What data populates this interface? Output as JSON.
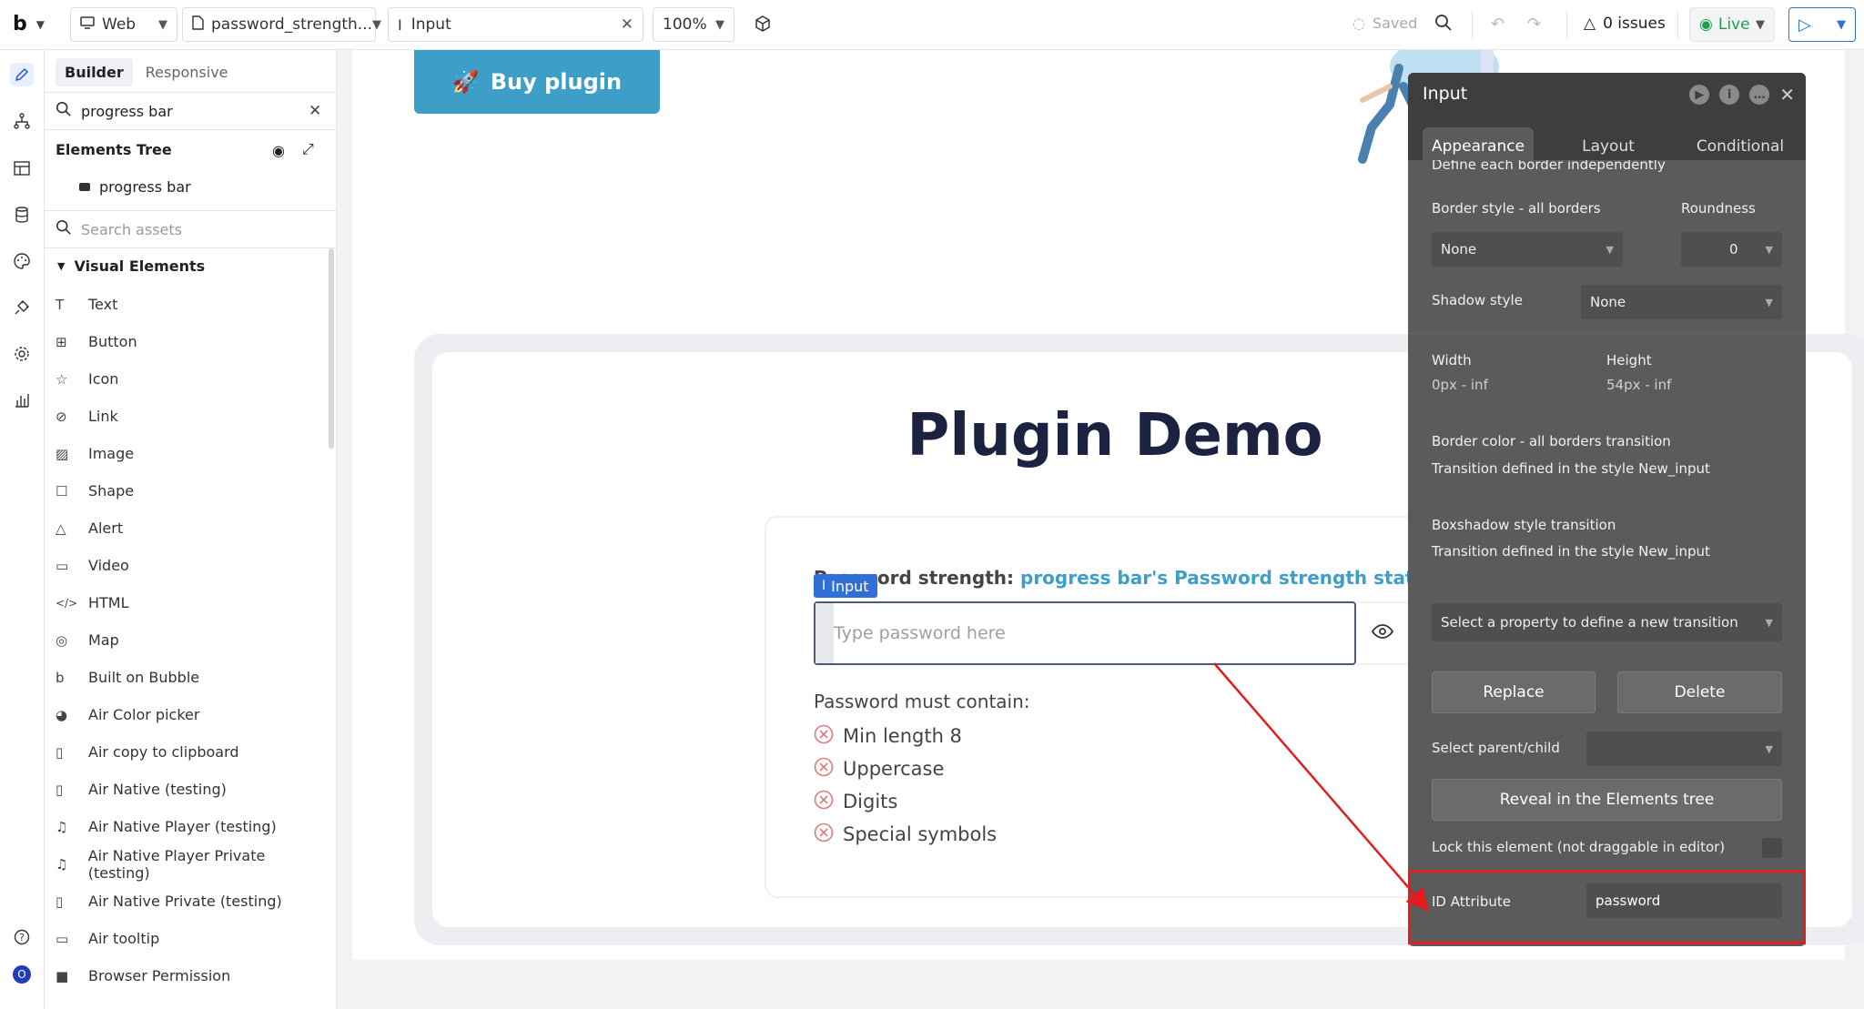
{
  "topbar": {
    "platform": "Web",
    "page": "password_strength...",
    "element": "Input",
    "zoom": "100%",
    "saved": "Saved",
    "issues": "0 issues",
    "live": "Live"
  },
  "sidebar": {
    "tabs": [
      "Builder",
      "Responsive"
    ],
    "search_value": "progress bar",
    "tree_title": "Elements Tree",
    "tree_item": "progress bar",
    "assets_placeholder": "Search assets",
    "category": "Visual Elements",
    "elements": [
      {
        "label": "Text",
        "icon": "text-icon"
      },
      {
        "label": "Button",
        "icon": "button-icon"
      },
      {
        "label": "Icon",
        "icon": "star-icon"
      },
      {
        "label": "Link",
        "icon": "link-icon"
      },
      {
        "label": "Image",
        "icon": "image-icon"
      },
      {
        "label": "Shape",
        "icon": "square-icon"
      },
      {
        "label": "Alert",
        "icon": "warning-icon"
      },
      {
        "label": "Video",
        "icon": "video-icon"
      },
      {
        "label": "HTML",
        "icon": "code-icon"
      },
      {
        "label": "Map",
        "icon": "map-pin-icon"
      },
      {
        "label": "Built on Bubble",
        "icon": "bubble-logo-icon"
      },
      {
        "label": "Air Color picker",
        "icon": "palette-icon"
      },
      {
        "label": "Air copy to clipboard",
        "icon": "clipboard-icon"
      },
      {
        "label": "Air Native (testing)",
        "icon": "phone-icon"
      },
      {
        "label": "Air Native Player (testing)",
        "icon": "music-icon"
      },
      {
        "label": "Air Native Player Private (testing)",
        "icon": "music-icon"
      },
      {
        "label": "Air Native Private (testing)",
        "icon": "phone-icon"
      },
      {
        "label": "Air tooltip",
        "icon": "tooltip-icon"
      },
      {
        "label": "Browser Permission",
        "icon": "square-filled-icon"
      }
    ]
  },
  "canvas": {
    "buy_button": "Buy plugin",
    "demo_title": "Plugin Demo",
    "strength_label": "Password strength:",
    "strength_dynamic": "progress bar's Password strength status",
    "input_badge": "Input",
    "password_placeholder": "Type password here",
    "must_contain": "Password must contain:",
    "rules": [
      "Min length 8",
      "Uppercase",
      "Digits",
      "Special symbols"
    ]
  },
  "property_editor": {
    "title": "Input",
    "tabs": [
      "Appearance",
      "Layout",
      "Conditional"
    ],
    "border_independent": "Define each border independently",
    "border_style_label": "Border style - all borders",
    "roundness_label": "Roundness",
    "border_style_value": "None",
    "roundness_value": "0",
    "shadow_label": "Shadow style",
    "shadow_value": "None",
    "width_label": "Width",
    "width_value": "0px - inf",
    "height_label": "Height",
    "height_value": "54px - inf",
    "border_transition_label": "Border color - all borders transition",
    "border_transition_value": "Transition defined in the style New_input",
    "boxshadow_transition_label": "Boxshadow style transition",
    "boxshadow_transition_value": "Transition defined in the style New_input",
    "select_property": "Select a property to define a new transition",
    "replace_button": "Replace",
    "delete_button": "Delete",
    "parent_child_label": "Select parent/child",
    "reveal_button": "Reveal in the Elements tree",
    "lock_label": "Lock this element (not draggable in editor)",
    "id_label": "ID Attribute",
    "id_value": "password"
  },
  "colors": {
    "accent_blue": "#3d9fc8",
    "highlight_red": "#e41c1c",
    "editor_bg": "#5b5b5b"
  }
}
